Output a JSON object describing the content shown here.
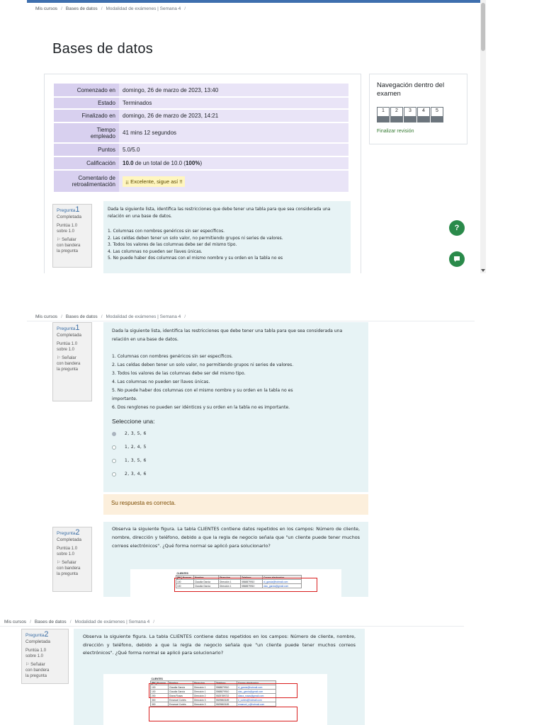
{
  "breadcrumb": {
    "my_courses": "Mis cursos",
    "course": "Bases de datos",
    "current": "Modalidad de exámenes | Semana 4",
    "sep": "/"
  },
  "course_title": "Bases de datos",
  "summary": {
    "started_label": "Comenzado en",
    "started_value": "domingo, 26 de marzo de 2023, 13:40",
    "state_label": "Estado",
    "state_value": "Terminados",
    "finished_label": "Finalizado en",
    "finished_value": "domingo, 26 de marzo de 2023, 14:21",
    "time_label_1": "Tiempo",
    "time_label_2": "empleado",
    "time_value": "41 mins 12 segundos",
    "points_label": "Puntos",
    "points_value": "5.0/5.0",
    "grade_label": "Calificación",
    "grade_score": "10.0",
    "grade_mid": " de un total de 10.0 (",
    "grade_pct": "100%",
    "grade_end": ")",
    "comment_label_1": "Comentario de",
    "comment_label_2": "retroalimentación",
    "comment_value": "¡¡ Excelente, sigue así !!"
  },
  "quiz_nav": {
    "title": "Navegación dentro del examen",
    "buttons": [
      "1",
      "2",
      "3",
      "4",
      "5"
    ],
    "finish": "Finalizar revisión"
  },
  "help_fab": "?",
  "q1": {
    "label": "Pregunta",
    "number": "1",
    "status": "Completada",
    "points_1": "Puntúa 1.0",
    "points_2": "sobre 1.0",
    "flag_1": "Señalar",
    "flag_2": "con bandera",
    "flag_3": "la pregunta",
    "intro": "Dada la siguiente lista, identifica las restricciones que debe tener una tabla para que sea considerada una relación en una base de datos.",
    "items": [
      "1. Columnas con nombres genéricos sin ser específicos.",
      "2. Las celdas deben tener un solo valor, no permitiendo grupos ni series de valores.",
      "3. Todos los valores de las columnas debe ser del mismo tipo.",
      "4. Las columnas no pueden ser llaves únicas.",
      "5. No puede haber dos columnas con el mismo nombre y su orden en la tabla no es importante.",
      "6. Dos renglones no pueden ser idénticos y su orden en la tabla no es importante."
    ],
    "item5_trunc": "5. No puede haber dos columnas con el mismo nombre y su orden en la tabla no es",
    "item5_a": "5. No puede haber dos columnas con el mismo nombre y su orden en la tabla no es",
    "item5_b": "importante.",
    "prompt": "Seleccione una:",
    "options": [
      "2, 3, 5, 6",
      "1, 2, 4, 5",
      "1, 3, 5, 6",
      "2, 3, 4, 6"
    ],
    "feedback": "Su respuesta es correcta."
  },
  "q2": {
    "label": "Pregunta",
    "number": "2",
    "status": "Completada",
    "points_1": "Puntúa 1.0",
    "points_2": "sobre 1.0",
    "flag_1": "Señalar",
    "flag_2": "con bandera",
    "flag_3": "la pregunta",
    "text": "Observa la siguiente figura. La tabla CLIENTES contiene datos repetidos en los campos: Número de cliente, nombre, dirección y teléfono, debido a que la regla de negocio señala que \"un cliente puede tener muchos correos electrónicos\". ¿Qué forma normal se aplicó para solucionarlo?"
  },
  "figure": {
    "title": "CLIENTES",
    "headers": [
      "[PK] Numero",
      "Nombre",
      "Direccion",
      "Telefono",
      "Correo electronico"
    ],
    "rows": [
      [
        "100",
        "Claudia García",
        "Dirección 1",
        "5568879910",
        "cl_garcia@hotmail.com"
      ],
      [
        "100",
        "Claudia García",
        "Dirección 1",
        "5568879910",
        "clau_garcia@gmail.com"
      ],
      [
        "200",
        "Diana Rosas",
        "Dirección 2",
        "5525789722",
        "diana_rosas@gmail.com"
      ],
      [
        "300",
        "Emanuel Cortés",
        "Dirección 3",
        "5529863189",
        "e_cortes@hotmail.com"
      ],
      [
        "300",
        "Emanuel Cortés",
        "Dirección 3",
        "5529863189",
        "emanuel_c@hotmail.com"
      ]
    ]
  }
}
